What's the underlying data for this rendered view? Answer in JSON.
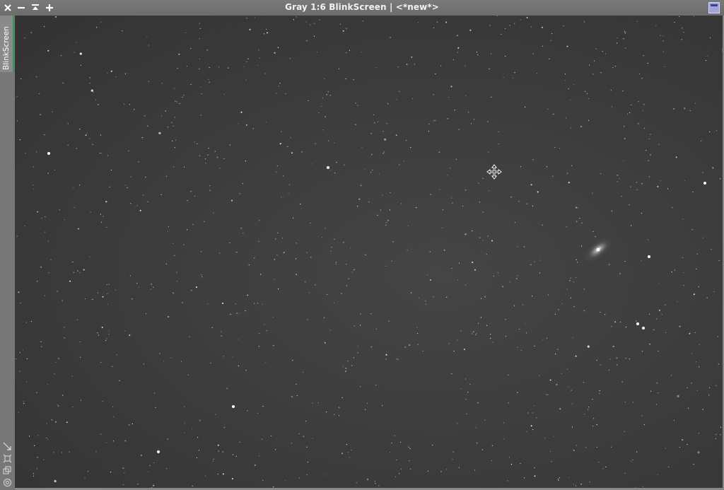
{
  "window": {
    "title": "Gray 1:6 BlinkScreen | <*new*>",
    "buttons": [
      "close",
      "minimize",
      "shade",
      "maximize-plus"
    ]
  },
  "sidebar": {
    "tab_label": "BlinkScreen",
    "accent_color": "#25a05a",
    "tools": [
      "zoom-to-fit-icon",
      "fit-view-icon",
      "clone-icon",
      "settings-icon"
    ]
  },
  "image": {
    "description_type": "astronomical star field",
    "colors": {
      "background": "#3d3d3d",
      "stars": "#ffffff"
    }
  }
}
